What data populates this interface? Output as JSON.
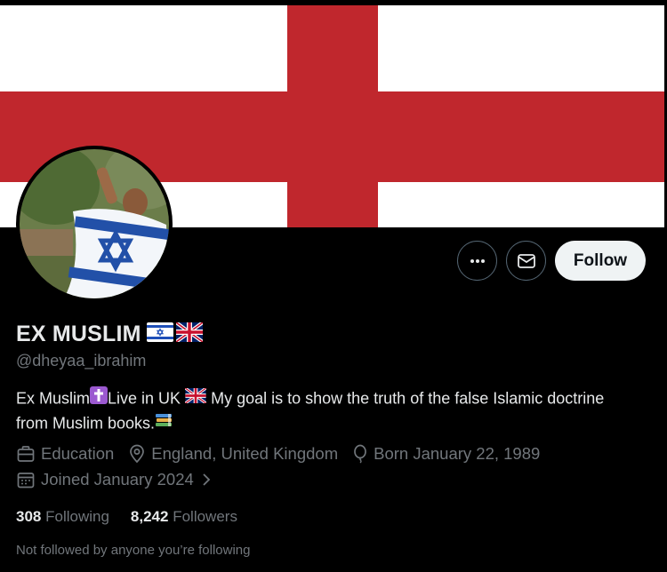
{
  "profile": {
    "display_name": "EX MUSLIM",
    "handle": "@dheyaa_ibrahim",
    "bio_part1": "Ex Muslim",
    "bio_part2": "Live in UK",
    "bio_part3": "My goal is to show the truth of the false Islamic doctrine from Muslim books.",
    "category": "Education",
    "location": "England, United Kingdom",
    "birthday": "Born January 22, 1989",
    "joined": "Joined January 2024",
    "following_count": "308",
    "following_label": "Following",
    "followers_count": "8,242",
    "followers_label": "Followers",
    "not_followed_text": "Not followed by anyone you’re following"
  },
  "actions": {
    "follow_label": "Follow",
    "more_icon": "more-icon",
    "message_icon": "envelope-icon"
  },
  "colors": {
    "background": "#000000",
    "banner_red": "#c0272d",
    "follow_button_bg": "#eff3f4",
    "secondary_text": "#71767b",
    "primary_text": "#e7e9ea"
  }
}
